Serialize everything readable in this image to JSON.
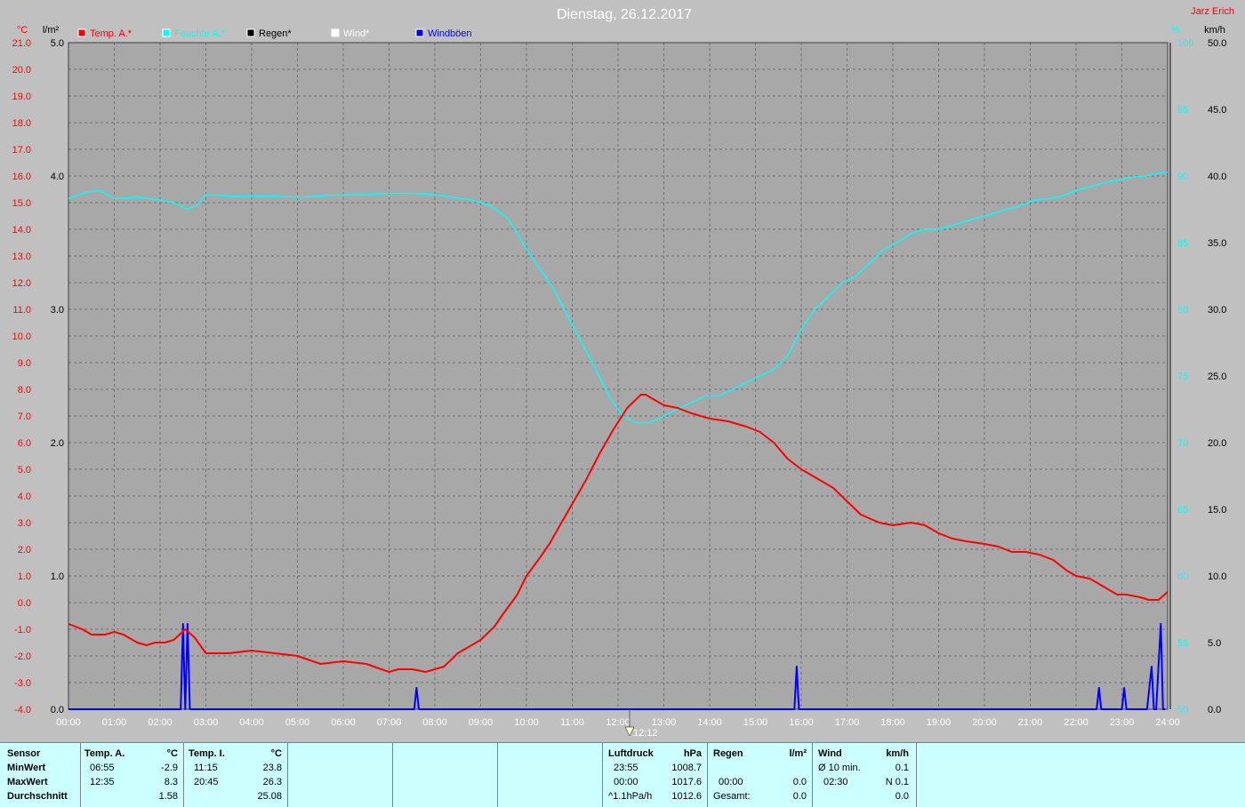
{
  "title": "Dienstag, 26.12.2017",
  "author": "Jarz Erich",
  "axes": {
    "left_temp_unit": "°C",
    "left_rain_unit": "l/m²",
    "right_humidity_unit": "%",
    "right_wind_unit": "km/h",
    "cursor_label": "12:12"
  },
  "legend": [
    {
      "label": "Temp. A.*",
      "color": "#ff0000"
    },
    {
      "label": "Feuchte A.*",
      "color": "#00ffff"
    },
    {
      "label": "Regen*",
      "color": "#000000"
    },
    {
      "label": "Wind*",
      "color": "#ffffff"
    },
    {
      "label": "Windböen",
      "color": "#0000ff"
    }
  ],
  "chart_data": {
    "type": "line",
    "title": "Dienstag, 26.12.2017",
    "x_ticks": [
      "00:00",
      "01:00",
      "02:00",
      "03:00",
      "04:00",
      "05:00",
      "06:00",
      "07:00",
      "08:00",
      "09:00",
      "10:00",
      "11:00",
      "12:00",
      "13:00",
      "14:00",
      "15:00",
      "16:00",
      "17:00",
      "18:00",
      "19:00",
      "20:00",
      "21:00",
      "22:00",
      "23:00",
      "24:00"
    ],
    "xlim_hours": [
      0,
      24
    ],
    "temp_axis": {
      "ylim": [
        -4,
        21
      ],
      "ticks": [
        "21.0",
        "20.0",
        "19.0",
        "18.0",
        "17.0",
        "16.0",
        "15.0",
        "14.0",
        "13.0",
        "12.0",
        "11.0",
        "10.0",
        "9.0",
        "8.0",
        "7.0",
        "6.0",
        "5.0",
        "4.0",
        "3.0",
        "2.0",
        "1.0",
        "0.0",
        "-1.0",
        "-2.0",
        "-3.0",
        "-4.0"
      ]
    },
    "rain_axis": {
      "ylim": [
        0,
        5
      ],
      "ticks": [
        "5.0",
        "4.0",
        "3.0",
        "2.0",
        "1.0",
        "0.0"
      ]
    },
    "humidity_axis": {
      "ylim": [
        50,
        100
      ],
      "ticks": [
        "100",
        "95",
        "90",
        "85",
        "80",
        "75",
        "70",
        "65",
        "60",
        "55",
        "50"
      ]
    },
    "wind_axis": {
      "ylim": [
        0,
        50
      ],
      "ticks": [
        "50.0",
        "45.0",
        "40.0",
        "35.0",
        "30.0",
        "25.0",
        "20.0",
        "15.0",
        "10.0",
        "5.0",
        "0.0"
      ]
    },
    "series": [
      {
        "name": "Temp. A.*",
        "color": "#ff0000",
        "axis": "temp",
        "x": [
          0,
          0.3,
          0.5,
          0.8,
          1.0,
          1.2,
          1.5,
          1.7,
          1.9,
          2.1,
          2.3,
          2.55,
          2.75,
          3.0,
          3.5,
          4.0,
          4.5,
          5.0,
          5.5,
          6.0,
          6.5,
          7.0,
          7.2,
          7.5,
          7.8,
          8.0,
          8.2,
          8.5,
          8.8,
          9.0,
          9.3,
          9.5,
          9.8,
          10.0,
          10.3,
          10.5,
          10.7,
          11.0,
          11.3,
          11.6,
          11.9,
          12.2,
          12.5,
          12.6,
          12.8,
          13.0,
          13.3,
          13.6,
          14.0,
          14.4,
          14.8,
          15.1,
          15.4,
          15.7,
          16.0,
          16.3,
          16.7,
          17.0,
          17.3,
          17.7,
          18.0,
          18.4,
          18.7,
          19.0,
          19.3,
          19.6,
          20.0,
          20.3,
          20.6,
          20.9,
          21.2,
          21.5,
          21.8,
          22.0,
          22.3,
          22.6,
          22.9,
          23.1,
          23.4,
          23.6,
          23.8,
          24.0
        ],
        "y": [
          -0.8,
          -1.0,
          -1.2,
          -1.2,
          -1.1,
          -1.2,
          -1.5,
          -1.6,
          -1.5,
          -1.5,
          -1.4,
          -1.0,
          -1.3,
          -1.9,
          -1.9,
          -1.8,
          -1.9,
          -2.0,
          -2.3,
          -2.2,
          -2.3,
          -2.6,
          -2.5,
          -2.5,
          -2.6,
          -2.5,
          -2.4,
          -1.9,
          -1.6,
          -1.4,
          -0.9,
          -0.4,
          0.3,
          1.0,
          1.7,
          2.2,
          2.8,
          3.7,
          4.6,
          5.6,
          6.5,
          7.3,
          7.8,
          7.8,
          7.6,
          7.4,
          7.3,
          7.1,
          6.9,
          6.8,
          6.6,
          6.4,
          6.0,
          5.4,
          5.0,
          4.7,
          4.3,
          3.8,
          3.3,
          3.0,
          2.9,
          3.0,
          2.9,
          2.6,
          2.4,
          2.3,
          2.2,
          2.1,
          1.9,
          1.9,
          1.8,
          1.6,
          1.2,
          1.0,
          0.9,
          0.6,
          0.3,
          0.3,
          0.2,
          0.1,
          0.1,
          0.4
        ]
      },
      {
        "name": "Feuchte A.*",
        "color": "#00ffff",
        "axis": "humidity",
        "x": [
          0,
          0.4,
          0.7,
          1.0,
          1.5,
          2.0,
          2.3,
          2.6,
          2.8,
          3.0,
          3.5,
          4.0,
          4.5,
          5.0,
          5.5,
          6.0,
          6.5,
          7.0,
          7.5,
          8.0,
          8.4,
          8.8,
          9.2,
          9.6,
          10.0,
          10.3,
          10.6,
          10.9,
          11.2,
          11.5,
          11.8,
          12.1,
          12.4,
          12.7,
          13.0,
          13.3,
          13.6,
          13.9,
          14.2,
          14.5,
          14.8,
          15.1,
          15.4,
          15.7,
          16.0,
          16.3,
          16.6,
          16.9,
          17.2,
          17.5,
          17.8,
          18.1,
          18.4,
          18.7,
          19.0,
          19.3,
          19.6,
          19.9,
          20.2,
          20.5,
          20.8,
          21.1,
          21.4,
          21.7,
          22.0,
          22.3,
          22.6,
          22.9,
          23.2,
          23.5,
          23.8,
          24.0
        ],
        "y": [
          88.3,
          88.8,
          88.9,
          88.3,
          88.4,
          88.2,
          88.0,
          87.5,
          87.8,
          88.6,
          88.5,
          88.5,
          88.5,
          88.4,
          88.5,
          88.6,
          88.6,
          88.7,
          88.7,
          88.6,
          88.4,
          88.2,
          87.8,
          86.8,
          84.5,
          83.0,
          81.5,
          79.5,
          77.5,
          75.6,
          73.5,
          72.0,
          71.5,
          71.5,
          72.0,
          72.5,
          73.0,
          73.5,
          73.5,
          74.0,
          74.5,
          75.0,
          75.5,
          76.5,
          78.5,
          80.0,
          81.0,
          82.0,
          82.5,
          83.5,
          84.5,
          85.0,
          85.7,
          86.0,
          86.0,
          86.3,
          86.6,
          86.9,
          87.2,
          87.5,
          87.8,
          88.2,
          88.3,
          88.5,
          88.9,
          89.2,
          89.5,
          89.7,
          89.9,
          90.0,
          90.2,
          90.3
        ]
      },
      {
        "name": "Windböen",
        "color": "#0000ff",
        "axis": "wind",
        "x": [
          0,
          2.45,
          2.5,
          2.55,
          2.6,
          2.65,
          7.55,
          7.6,
          7.65,
          15.85,
          15.9,
          15.95,
          22.45,
          22.5,
          22.55,
          23.0,
          23.05,
          23.1,
          23.55,
          23.65,
          23.7,
          23.75,
          23.85,
          23.9,
          23.95
        ],
        "y": [
          0,
          0,
          6.4,
          0,
          6.4,
          0,
          0,
          1.6,
          0,
          0,
          3.2,
          0,
          0,
          1.6,
          0,
          0,
          1.6,
          0,
          0,
          3.2,
          0,
          0,
          6.4,
          0,
          0
        ]
      }
    ]
  },
  "summary": {
    "sensor": {
      "header": "Sensor",
      "rows": [
        "MinWert",
        "MaxWert",
        "Durchschnitt"
      ]
    },
    "temp_a": {
      "header": "Temp. A.",
      "unit": "°C",
      "times": [
        "06:55",
        "12:35",
        ""
      ],
      "values": [
        "-2.9",
        "8.3",
        "1.58"
      ]
    },
    "temp_i": {
      "header": "Temp. I.",
      "unit": "°C",
      "times": [
        "11:15",
        "20:45",
        ""
      ],
      "values": [
        "23.8",
        "26.3",
        "25.08"
      ]
    },
    "pressure": {
      "header": "Luftdruck",
      "unit": "hPa",
      "times": [
        "23:55",
        "00:00",
        "^1.1hPa/h"
      ],
      "values": [
        "1008.7",
        "1017.6",
        "1012.6"
      ]
    },
    "rain": {
      "header": "Regen",
      "unit": "l/m²",
      "times": [
        "",
        "00:00",
        "Gesamt:"
      ],
      "values": [
        "",
        "0.0",
        "0.0"
      ]
    },
    "wind": {
      "header": "Wind",
      "unit": "km/h",
      "times": [
        "Ø 10 min.",
        "02:30",
        ""
      ],
      "values": [
        "0.1",
        "N 0.1",
        "0.0"
      ]
    }
  }
}
